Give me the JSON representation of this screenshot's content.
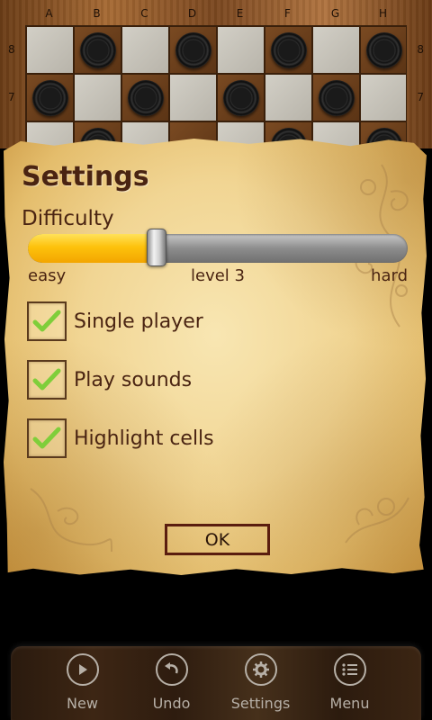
{
  "board": {
    "columns": [
      "A",
      "B",
      "C",
      "D",
      "E",
      "F",
      "G",
      "H"
    ],
    "rows": [
      {
        "label": "8",
        "cells": [
          "light",
          "dark-piece",
          "light",
          "dark-piece",
          "light",
          "dark-piece",
          "light",
          "dark-piece"
        ]
      },
      {
        "label": "7",
        "cells": [
          "dark-piece",
          "light",
          "dark-piece",
          "light",
          "dark-piece",
          "light",
          "dark-piece",
          "light"
        ]
      },
      {
        "label": "6",
        "cells": [
          "light",
          "dark-piece",
          "light",
          "dark",
          "light",
          "dark-piece",
          "light",
          "dark-piece"
        ]
      }
    ]
  },
  "settings": {
    "title": "Settings",
    "difficulty": {
      "label": "Difficulty",
      "min_label": "easy",
      "value_label": "level 3",
      "max_label": "hard",
      "value_fraction": 0.34
    },
    "options": [
      {
        "label": "Single player",
        "checked": true
      },
      {
        "label": "Play sounds",
        "checked": true
      },
      {
        "label": "Highlight cells",
        "checked": true
      }
    ],
    "ok_label": "OK"
  },
  "toolbar": {
    "items": [
      {
        "label": "New",
        "icon": "play-icon"
      },
      {
        "label": "Undo",
        "icon": "undo-icon"
      },
      {
        "label": "Settings",
        "icon": "gear-icon"
      },
      {
        "label": "Menu",
        "icon": "list-icon"
      }
    ]
  },
  "colors": {
    "slider_fill": "#fdc20c",
    "text_brown": "#4a2412",
    "checkmark_green": "#7fce3a"
  }
}
